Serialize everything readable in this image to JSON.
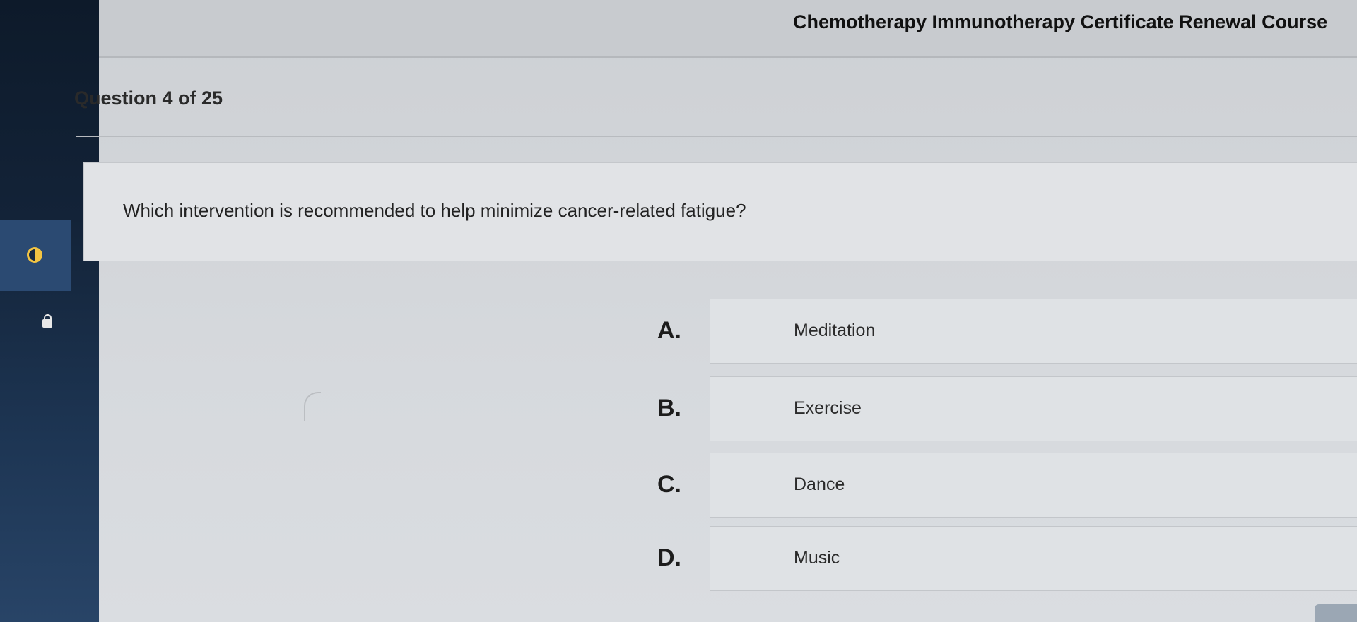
{
  "header": {
    "course_title": "Chemotherapy Immunotherapy Certificate Renewal Course"
  },
  "quiz": {
    "question_counter": "Question 4 of 25",
    "question_text": "Which intervention is recommended to help minimize cancer-related fatigue?",
    "answers": [
      {
        "letter": "A.",
        "text": "Meditation"
      },
      {
        "letter": "B.",
        "text": "Exercise"
      },
      {
        "letter": "C.",
        "text": "Dance"
      },
      {
        "letter": "D.",
        "text": "Music"
      }
    ]
  },
  "sidebar": {
    "icons": [
      "timer-icon",
      "lock-icon"
    ]
  },
  "colors": {
    "sidebar": "#132338",
    "timer_accent": "#f4c542",
    "background": "#d6d9dd"
  }
}
